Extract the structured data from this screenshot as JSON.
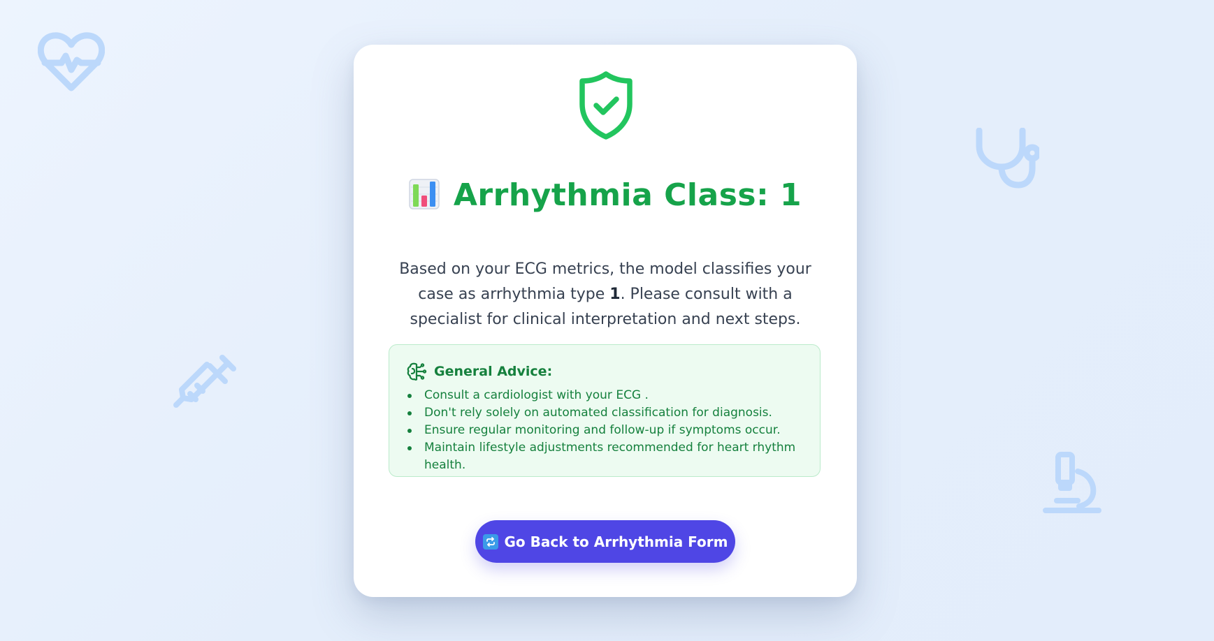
{
  "colors": {
    "accent_green": "#16a34a",
    "advice_text": "#15803d",
    "button_bg": "#4f46e5",
    "background_icon": "#bcd8fb"
  },
  "background_icons": [
    "heart-pulse-icon",
    "stethoscope-icon",
    "syringe-icon",
    "microscope-icon"
  ],
  "result": {
    "status_icon": "shield-check-icon",
    "title_icon": "bar-chart-emoji-icon",
    "title": "Arrhythmia Class: 1",
    "description_pre": "Based on your ECG metrics, the model classifies your case as arrhythmia type ",
    "description_class": "1",
    "description_post": ". Please consult with a specialist for clinical interpretation and next steps."
  },
  "advice": {
    "icon": "brain-icon",
    "heading": "General Advice:",
    "items": [
      "Consult a cardiologist with your ECG .",
      "Don't rely solely on automated classification for diagnosis.",
      "Ensure regular monitoring and follow-up if symptoms occur.",
      "Maintain lifestyle adjustments recommended for heart rhythm health."
    ]
  },
  "back_button": {
    "icon": "repeat-icon",
    "label": "Go Back to Arrhythmia Form"
  }
}
